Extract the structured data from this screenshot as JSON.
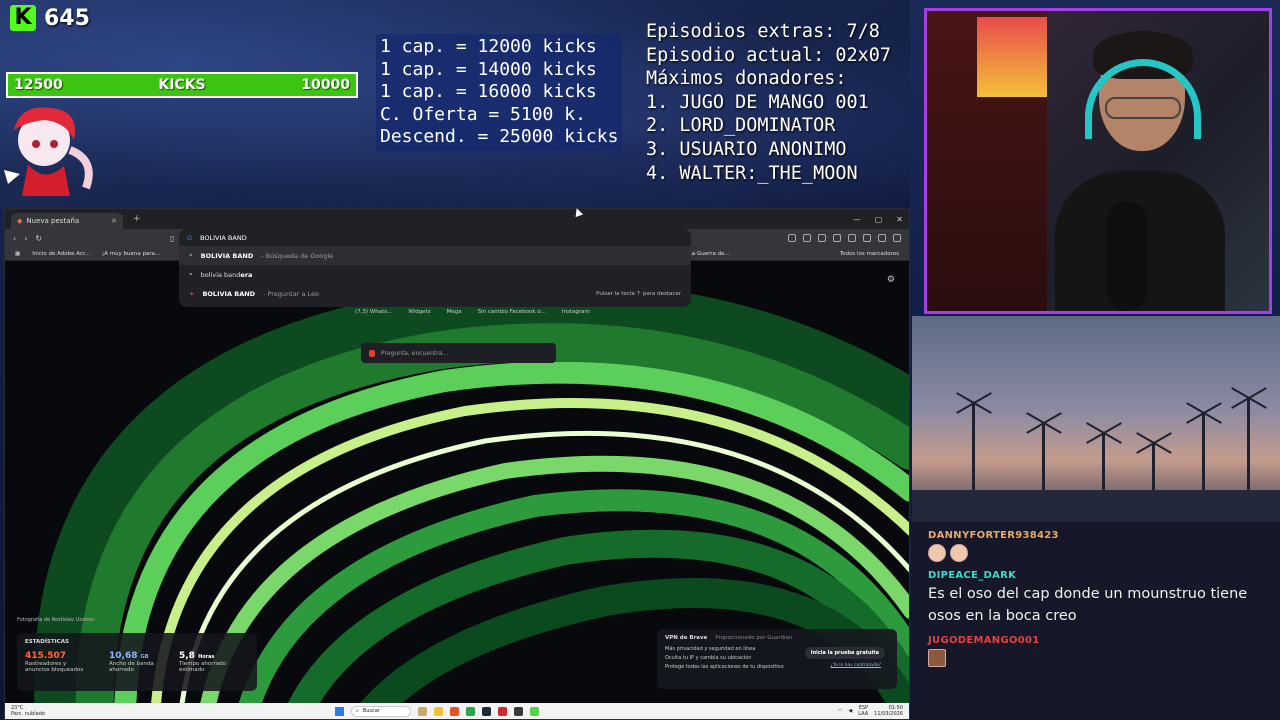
{
  "overlay": {
    "kick_count": "645",
    "goal_bar": {
      "left": "12500",
      "label": "KICKS",
      "right": "10000"
    },
    "prices": [
      "1 cap. = 12000 kicks",
      "1 cap. = 14000 kicks",
      "1 cap. = 16000 kicks",
      "C. Oferta = 5100 k.",
      "Descend. = 25000 kicks"
    ],
    "episodes": [
      "Episodios extras: 7/8",
      "Episodio actual: 02x07",
      "Máximos donadores:",
      "1. JUGO DE MANGO 001",
      "2. LORD_DOMINATOR",
      "3. USUARIO ANONIMO",
      "4. WALTER:_THE_MOON"
    ]
  },
  "browser": {
    "tab_title": "Nueva pestaña",
    "url_text": "BOLIVIA BAND",
    "suggestions": [
      {
        "bold": "BOLIVIA BAND",
        "sub": " - Búsqueda de Google",
        "hint": ""
      },
      {
        "bold": "bolivia band",
        "sub": "era",
        "hint": ""
      },
      {
        "bold": "BOLIVIA BAND",
        "sub": " - Preguntar a Leo",
        "hint": "Pulsar la tecla ↑ para destacar"
      }
    ],
    "bookmarks": [
      "Inicio de Adobe Acr...",
      "¡A muy buena para...",
      "(160) La Guerra de..."
    ],
    "bookmarks_all": "Todos los marcadores",
    "quick_links": [
      "(7,3) Whats...",
      "Widgets",
      "Mega",
      "Sin cambio Facebook o...",
      "Instagram"
    ],
    "search_placeholder": "Pregunta, encuentra...",
    "photo_credit": "Fotografía de Rostislav Uzunov",
    "stats": {
      "title": "ESTADÍSTICAS",
      "items": [
        {
          "value": "415.507",
          "label": "Rastreadores y anuncios bloqueados"
        },
        {
          "value": "10,68",
          "unit": "GB",
          "label": "Ancho de banda ahorrado"
        },
        {
          "value": "5,8",
          "unit": "Horas",
          "label": "Tiempo ahorrado estimado"
        }
      ]
    },
    "vpn": {
      "title": "VPN de Brave",
      "subtitle": "Proporcionado por Guardian",
      "lines": [
        "Más privacidad y seguridad en línea",
        "Oculta tu IP y cambia su ubicación",
        "Protege todas las aplicaciones de tu dispositivo"
      ],
      "button": "Inicia la prueba gratuita",
      "link": "¿Ya lo has contratado?"
    },
    "taskbar": {
      "weather_temp": "23°C",
      "weather_desc": "Parc. nublado",
      "search": "Buscar",
      "lang_top": "ESP",
      "lang_bottom": "LAA",
      "time": "01:50",
      "date": "11/03/2026"
    }
  },
  "chat": [
    {
      "user": "DANNYFORTER938423",
      "color": "#e8a86a",
      "text": "",
      "emotes": 2
    },
    {
      "user": "DIPEACE_DARK",
      "color": "#40d8c8",
      "text": "Es el oso del cap donde un mounstruo tiene osos en la boca creo",
      "emotes": 0
    },
    {
      "user": "JUGODEMANGO001",
      "color": "#e84040",
      "text": "",
      "emotes": 1
    }
  ],
  "colors": {
    "kick_green": "#53fc18",
    "webcam_border": "#a43ee8",
    "chat_bg": "#161729"
  }
}
